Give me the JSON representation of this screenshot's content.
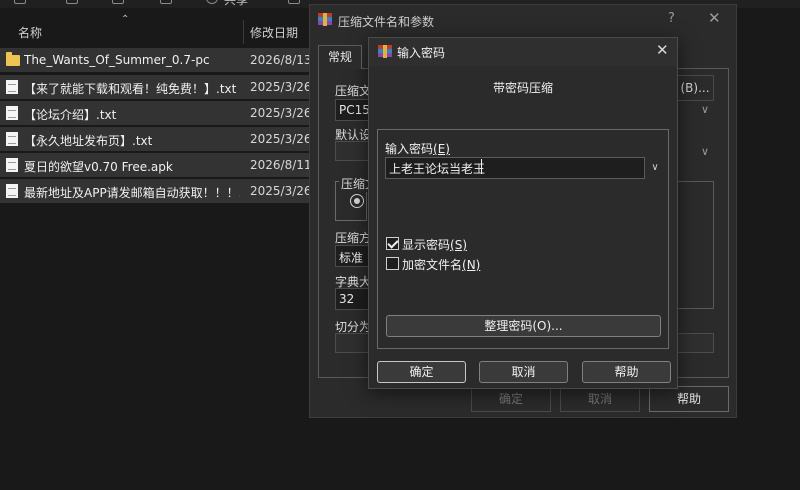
{
  "explorer": {
    "toolbar_partial_text": "共享",
    "columns": {
      "name": "名称",
      "modified": "修改日期"
    },
    "files": [
      {
        "name": "The_Wants_Of_Summer_0.7-pc",
        "date": "2026/8/13",
        "icon": "folder-icon"
      },
      {
        "name": "【来了就能下载和观看！纯免费！】.txt",
        "date": "2025/3/26",
        "icon": "text-file-icon"
      },
      {
        "name": "【论坛介绍】.txt",
        "date": "2025/3/26",
        "icon": "text-file-icon"
      },
      {
        "name": "【永久地址发布页】.txt",
        "date": "2025/3/26",
        "icon": "text-file-icon"
      },
      {
        "name": "夏日的欲望v0.70 Free.apk",
        "date": "2026/8/11",
        "icon": "file-icon"
      },
      {
        "name": "最新地址及APP请发邮箱自动获取！！！....",
        "date": "2025/3/26",
        "icon": "text-file-icon"
      }
    ]
  },
  "compress_dialog": {
    "title": "压缩文件名和参数",
    "help": "?",
    "close": "✕",
    "tab": "常规",
    "archive_label": "压缩文",
    "archive_value": "PC158",
    "browse_btn": "(B)...",
    "default_label": "默认设",
    "format_group": "压缩文",
    "method_label": "压缩方",
    "method_value": "标准",
    "dict_label": "字典大",
    "dict_value": "32",
    "split_label": "切分为",
    "ok": "确定",
    "cancel": "取消",
    "help_btn": "帮助"
  },
  "password_dialog": {
    "title": "输入密码",
    "close": "✕",
    "subtitle": "带密码压缩",
    "input_label": "输入密码",
    "input_hotkey": "(E)",
    "password_value": "上老王论坛当老王",
    "show_password_label": "显示密码",
    "show_password_hotkey": "(S)",
    "show_password_checked": true,
    "encrypt_names_label": "加密文件名",
    "encrypt_names_hotkey": "(N)",
    "encrypt_names_checked": false,
    "organize_btn": "整理密码(O)...",
    "ok": "确定",
    "cancel": "取消",
    "help": "帮助"
  }
}
